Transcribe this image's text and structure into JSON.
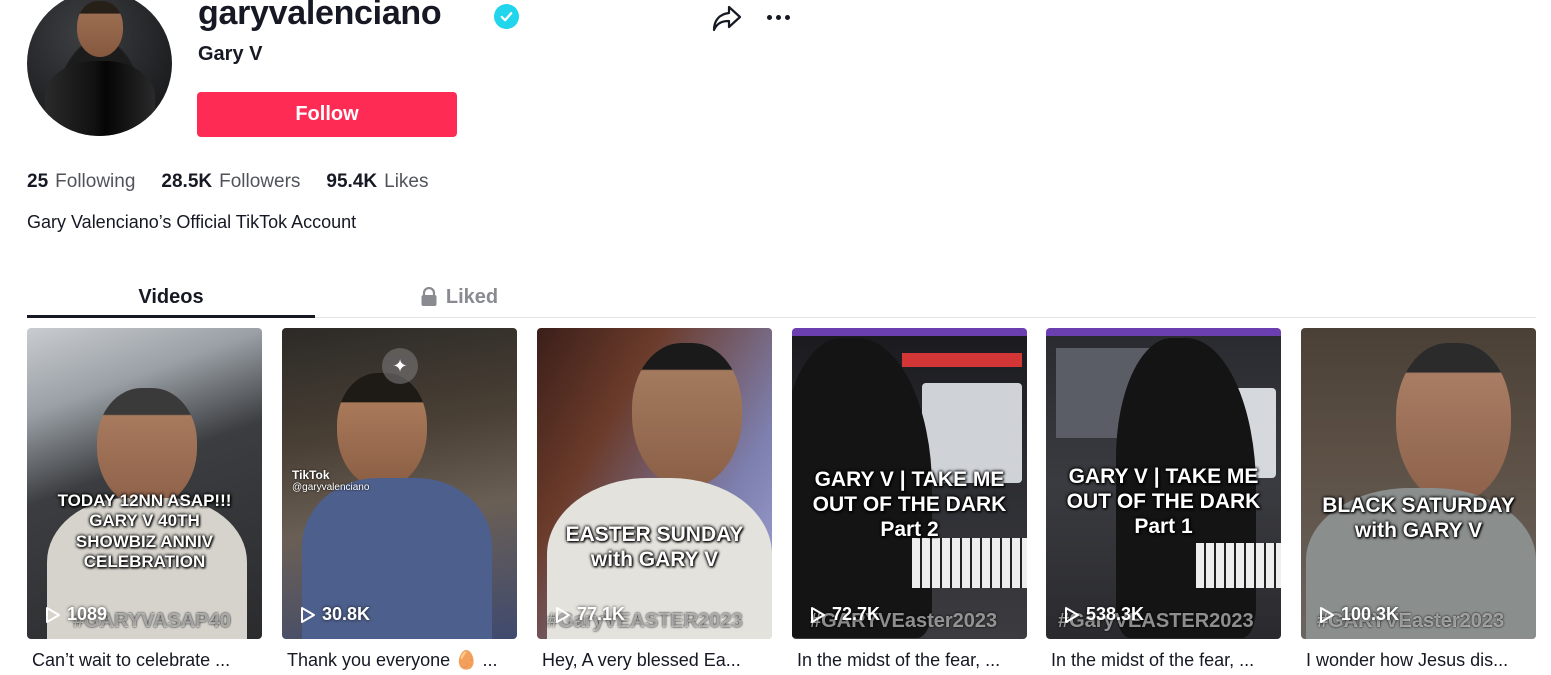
{
  "profile": {
    "username": "garyvalenciano",
    "nickname": "Gary V",
    "follow_label": "Follow",
    "bio": "Gary Valenciano’s Official TikTok Account",
    "stats": [
      {
        "value": "25",
        "label": "Following"
      },
      {
        "value": "28.5K",
        "label": "Followers"
      },
      {
        "value": "95.4K",
        "label": "Likes"
      }
    ]
  },
  "tabs": [
    {
      "label": "Videos",
      "active": true
    },
    {
      "label": "Liked",
      "active": false,
      "icon": "lock-icon"
    }
  ],
  "videos": [
    {
      "overlay": "TODAY 12NN ASAP!!!\nGARY V 40TH\nSHOWBIZ ANNIV\nCELEBRATION",
      "hashtag": "#GARYVASAP40",
      "views": "1089",
      "caption": "Can’t wait to celebrate ..."
    },
    {
      "overlay": "",
      "hashtag": "",
      "views": "30.8K",
      "caption": "Thank you everyone 🥚 ...",
      "watermark": "TikTok",
      "watermark_handle": "@garyvalenciano"
    },
    {
      "overlay": "EASTER SUNDAY\nwith GARY V",
      "hashtag": "#GaryVEASTER2023",
      "views": "77.1K",
      "caption": "Hey, A very blessed Ea..."
    },
    {
      "overlay": "GARY V | TAKE ME\nOUT OF THE DARK\nPart 2",
      "hashtag": "#GARYVEaster2023",
      "views": "72.7K",
      "caption": "In the midst of the fear, ..."
    },
    {
      "overlay": "GARY V | TAKE ME\nOUT OF THE DARK\nPart 1",
      "hashtag": "#GaryVEASTER2023",
      "views": "538.3K",
      "caption": "In the midst of the fear, ..."
    },
    {
      "overlay": "BLACK SATURDAY\nwith GARY V",
      "hashtag": "#GARYVEaster2023",
      "views": "100.3K",
      "caption": "I wonder how Jesus dis..."
    }
  ],
  "colors": {
    "primary": "#fe2c55",
    "verified": "#20d5ec",
    "text": "#161823"
  }
}
